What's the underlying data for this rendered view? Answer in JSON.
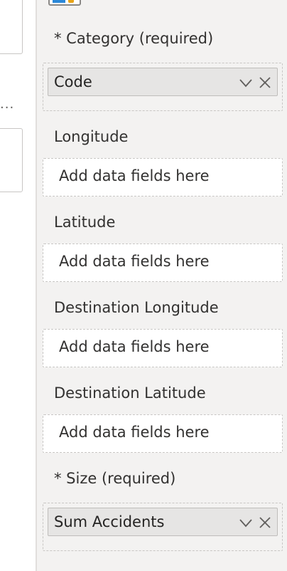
{
  "left_panel": {
    "ellipsis": "..."
  },
  "fields_pane": {
    "category": {
      "label": "* Category (required)",
      "field": "Code"
    },
    "longitude": {
      "label": "Longitude",
      "placeholder": "Add data fields here"
    },
    "latitude": {
      "label": "Latitude",
      "placeholder": "Add data fields here"
    },
    "destination_longitude": {
      "label": "Destination Longitude",
      "placeholder": "Add data fields here"
    },
    "destination_latitude": {
      "label": "Destination Latitude",
      "placeholder": "Add data fields here"
    },
    "size": {
      "label": "* Size (required)",
      "field": "Sum Accidents"
    }
  },
  "icons": {
    "visual_type": "visual-type-icon",
    "chevron": "chevron-down-icon",
    "remove": "close-icon"
  },
  "colors": {
    "panel_bg": "#f3f2f1",
    "pill_bg": "#e6e5e4",
    "accent_blue": "#2b88d8",
    "accent_orange": "#e8a317"
  }
}
